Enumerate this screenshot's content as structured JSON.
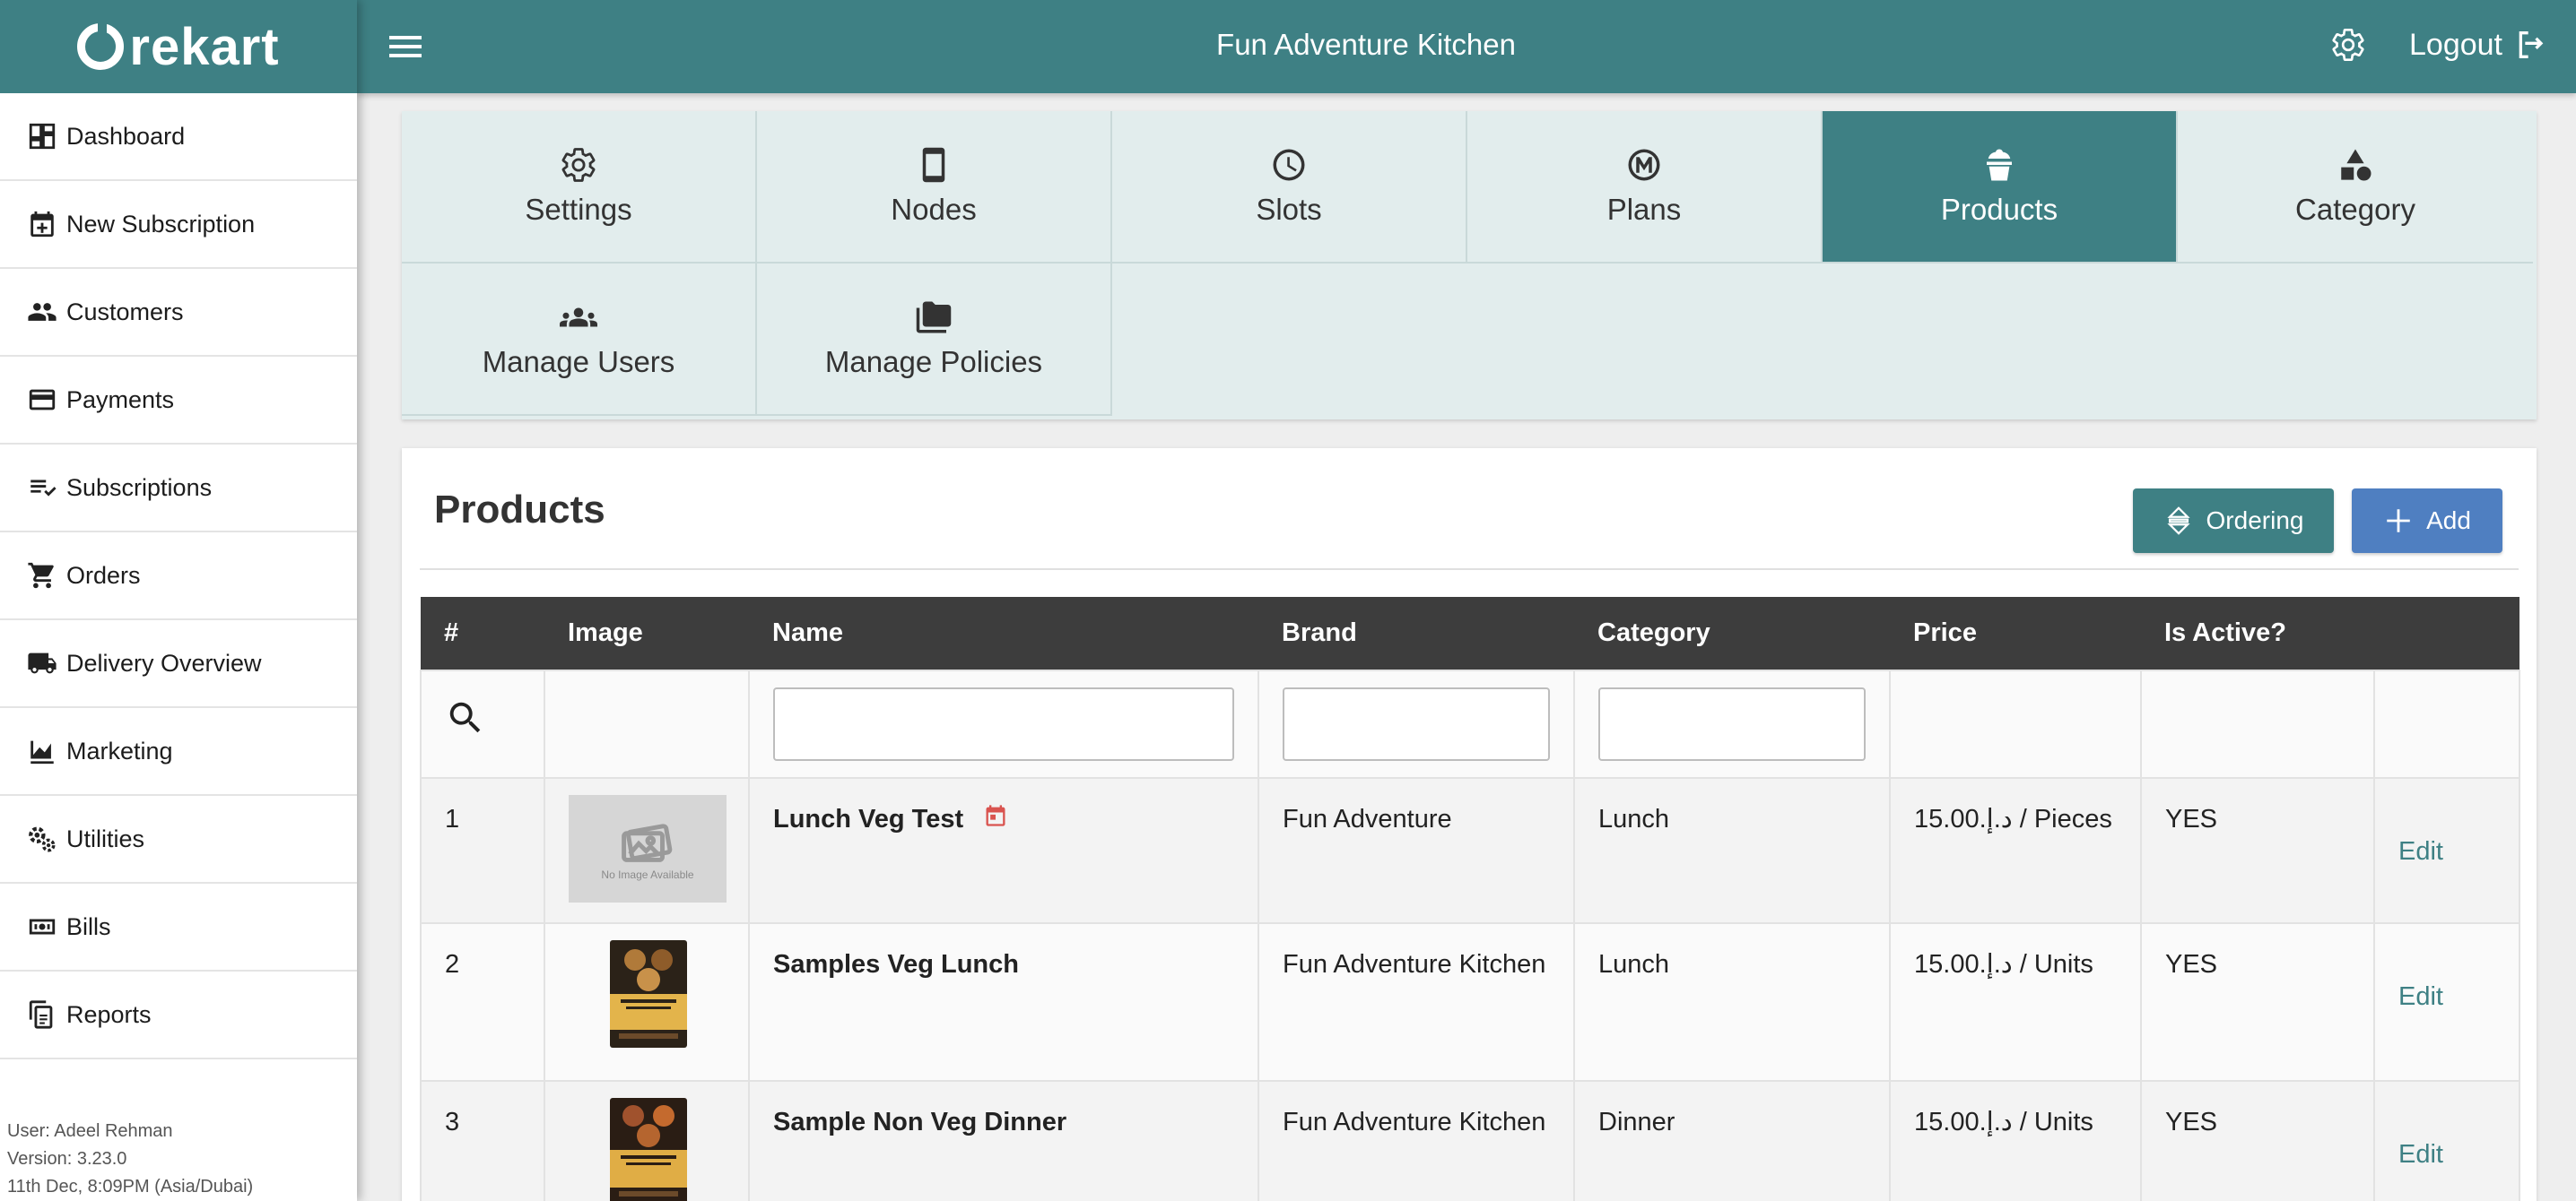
{
  "brand": {
    "name": "rekart"
  },
  "header": {
    "title": "Fun Adventure Kitchen",
    "settings_icon": "gear-icon",
    "logout_label": "Logout",
    "logout_icon": "logout-icon"
  },
  "sidebar": {
    "items": [
      {
        "label": "Dashboard",
        "icon": "dashboard-icon"
      },
      {
        "label": "New Subscription",
        "icon": "calendar-plus-icon"
      },
      {
        "label": "Customers",
        "icon": "people-icon"
      },
      {
        "label": "Payments",
        "icon": "credit-card-icon"
      },
      {
        "label": "Subscriptions",
        "icon": "list-check-icon"
      },
      {
        "label": "Orders",
        "icon": "cart-icon"
      },
      {
        "label": "Delivery Overview",
        "icon": "truck-icon"
      },
      {
        "label": "Marketing",
        "icon": "chart-area-icon"
      },
      {
        "label": "Utilities",
        "icon": "gears-icon"
      },
      {
        "label": "Bills",
        "icon": "bill-icon"
      },
      {
        "label": "Reports",
        "icon": "documents-icon"
      }
    ],
    "footer": {
      "user": "User: Adeel Rehman",
      "version": "Version: 3.23.0",
      "datetime": "11th Dec, 8:09PM (Asia/Dubai)"
    }
  },
  "tabs": [
    {
      "label": "Settings",
      "icon": "gear-icon"
    },
    {
      "label": "Nodes",
      "icon": "phone-icon"
    },
    {
      "label": "Slots",
      "icon": "clock-icon"
    },
    {
      "label": "Plans",
      "icon": "m-circle-icon"
    },
    {
      "label": "Products",
      "icon": "cupcake-icon",
      "active": true
    },
    {
      "label": "Category",
      "icon": "shapes-icon"
    },
    {
      "label": "Manage Users",
      "icon": "group-icon"
    },
    {
      "label": "Manage Policies",
      "icon": "folders-icon"
    }
  ],
  "products": {
    "title": "Products",
    "ordering_label": "Ordering",
    "add_label": "Add",
    "columns": [
      "#",
      "Image",
      "Name",
      "Brand",
      "Category",
      "Price",
      "Is Active?",
      ""
    ],
    "rows": [
      {
        "index": "1",
        "image": "No Image Available",
        "name": "Lunch Veg Test",
        "has_calendar": true,
        "brand": "Fun Adventure",
        "category": "Lunch",
        "price": "15.00.د.إ / Pieces",
        "active": "YES",
        "action": "Edit"
      },
      {
        "index": "2",
        "image": "menu-photo",
        "name": "Samples Veg Lunch",
        "brand": "Fun Adventure Kitchen",
        "category": "Lunch",
        "price": "15.00.د.إ / Units",
        "active": "YES",
        "action": "Edit"
      },
      {
        "index": "3",
        "image": "menu-photo",
        "name": "Sample Non Veg Dinner",
        "brand": "Fun Adventure Kitchen",
        "category": "Dinner",
        "price": "15.00.د.إ / Units",
        "active": "YES",
        "action": "Edit"
      }
    ]
  }
}
